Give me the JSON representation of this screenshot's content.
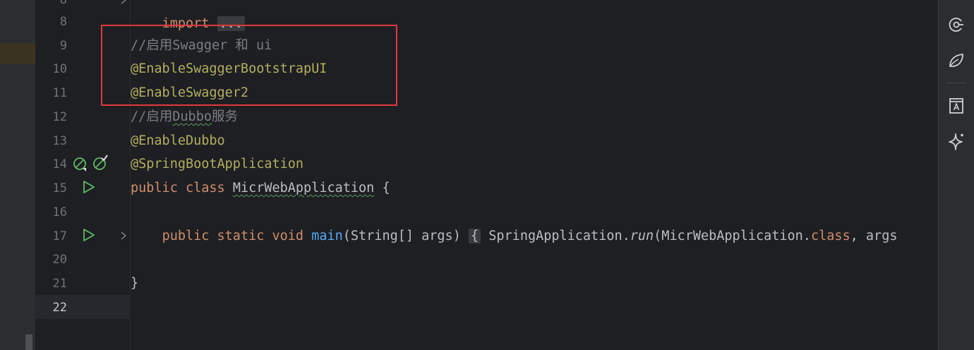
{
  "editor": {
    "line_numbers": [
      "8",
      "9",
      "10",
      "11",
      "12",
      "13",
      "14",
      "15",
      "16",
      "17",
      "20",
      "21",
      "22"
    ],
    "top_partial": {
      "keyword": "import",
      "fold": "..."
    },
    "lines": {
      "l9": "//启用Swagger 和 ui",
      "l10": "@EnableSwaggerBootstrapUI",
      "l11": "@EnableSwagger2",
      "l12_prefix": "//启用",
      "l12_word": "Dubbo",
      "l12_suffix": "服务",
      "l13": "@EnableDubbo",
      "l14": "@SpringBootApplication",
      "l15_public": "public",
      "l15_class": "class",
      "l15_name": "MicrWebApplication",
      "l15_brace": "{",
      "l17_public": "public",
      "l17_static": "static",
      "l17_void": "void",
      "l17_main": "main",
      "l17_params": "(String[] args)",
      "l17_brace": "{",
      "l17_call_obj": "SpringApplication.",
      "l17_call_fn": "run",
      "l17_call_arg1": "(MicrWebApplication.",
      "l17_class_kw": "class",
      "l17_rest": ", args",
      "l21": "}"
    }
  },
  "icons": {
    "gutter_l14": [
      "bean-icon",
      "bean-check-icon"
    ],
    "gutter_run": "run-icon",
    "fold": "chevron-right-icon",
    "toolbar": [
      "notifications-icon",
      "spring-icon",
      "translate-icon",
      "ai-assistant-icon"
    ]
  },
  "colors": {
    "background": "#1e1f22",
    "comment": "#7a7e85",
    "annotation": "#b3ae60",
    "keyword": "#cf8e6d",
    "function": "#56a8f5",
    "highlight_box": "#e0393e",
    "run_icon": "#5fb865"
  }
}
